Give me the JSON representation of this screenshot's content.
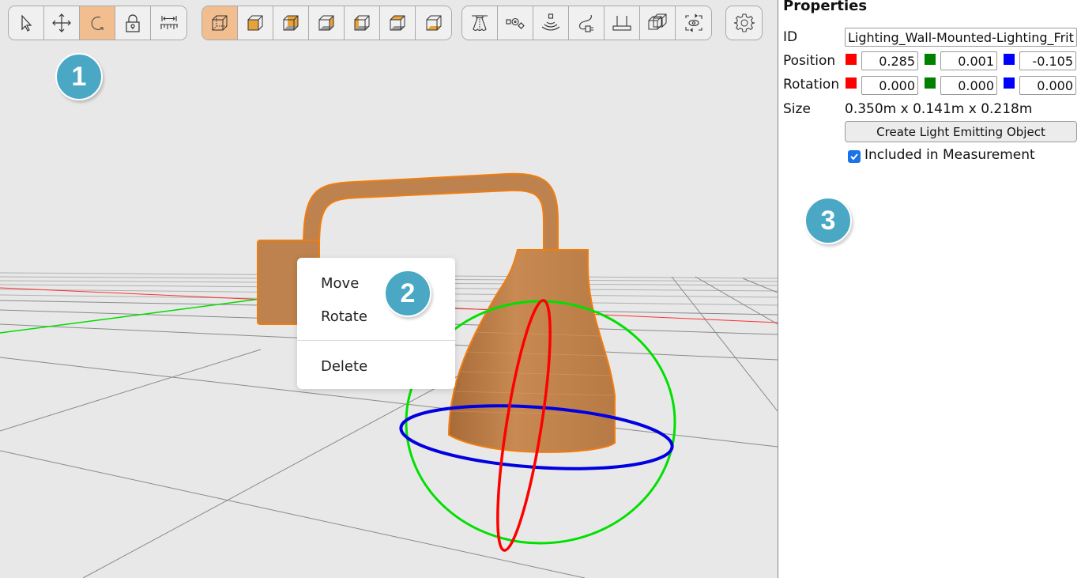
{
  "toolbar": {
    "groups": [
      {
        "name": "mode-tools",
        "buttons": [
          {
            "id": "select",
            "icon": "pointer-arrow-icon",
            "active": false
          },
          {
            "id": "move",
            "icon": "move-arrows-icon",
            "active": false
          },
          {
            "id": "rotate",
            "icon": "rotate-icon",
            "active": true
          },
          {
            "id": "lock",
            "icon": "padlock-icon",
            "active": false
          },
          {
            "id": "measure",
            "icon": "ruler-measure-icon",
            "active": false
          }
        ]
      },
      {
        "name": "view-cube",
        "buttons": [
          {
            "id": "view-perspective",
            "icon": "cube-perspective-icon",
            "active": true
          },
          {
            "id": "view-front",
            "icon": "cube-front-face-icon",
            "active": false
          },
          {
            "id": "view-back",
            "icon": "cube-back-face-icon",
            "active": false
          },
          {
            "id": "view-right",
            "icon": "cube-right-face-icon",
            "active": false
          },
          {
            "id": "view-left",
            "icon": "cube-left-face-icon",
            "active": false
          },
          {
            "id": "view-top",
            "icon": "cube-top-face-icon",
            "active": false
          },
          {
            "id": "view-bottom",
            "icon": "cube-bottom-face-icon",
            "active": false
          }
        ]
      },
      {
        "name": "object-tools",
        "buttons": [
          {
            "id": "ceiling-light",
            "icon": "ceiling-lamp-icon",
            "active": false
          },
          {
            "id": "shapes",
            "icon": "shapes-icon",
            "active": false
          },
          {
            "id": "sensor",
            "icon": "sensor-signal-icon",
            "active": false
          },
          {
            "id": "power-plug",
            "icon": "power-plug-icon",
            "active": false
          },
          {
            "id": "floor",
            "icon": "floor-plane-icon",
            "active": false
          },
          {
            "id": "xray",
            "icon": "overlapping-cubes-icon",
            "active": false
          },
          {
            "id": "camera-view",
            "icon": "eye-view-icon",
            "active": false
          }
        ]
      },
      {
        "name": "settings",
        "buttons": [
          {
            "id": "settings",
            "icon": "gear-icon",
            "active": false
          }
        ]
      }
    ]
  },
  "badges": [
    "1",
    "2",
    "3"
  ],
  "context_menu": {
    "items": [
      "Move",
      "Rotate",
      "Delete"
    ]
  },
  "properties": {
    "title": "Properties",
    "id_label": "ID",
    "id_value": "Lighting_Wall-Mounted-Lighting_Fritz-H",
    "position_label": "Position",
    "position": {
      "x": "0.285",
      "y": "0.001",
      "z": "-0.105"
    },
    "rotation_label": "Rotation",
    "rotation": {
      "x": "0.000",
      "y": "0.000",
      "z": "0.000"
    },
    "size_label": "Size",
    "size_value": "0.350m x 0.141m x 0.218m",
    "create_button": "Create Light Emitting Object",
    "included_checkbox": {
      "label": "Included in Measurement",
      "checked": true
    }
  },
  "colors": {
    "axis_x": "#ff0000",
    "axis_y": "#008000",
    "axis_z": "#0000ff",
    "active_tool": "#f2be8f",
    "badge": "#4aa8c5",
    "object": "#c0824a",
    "object_outline": "#f07d10"
  }
}
